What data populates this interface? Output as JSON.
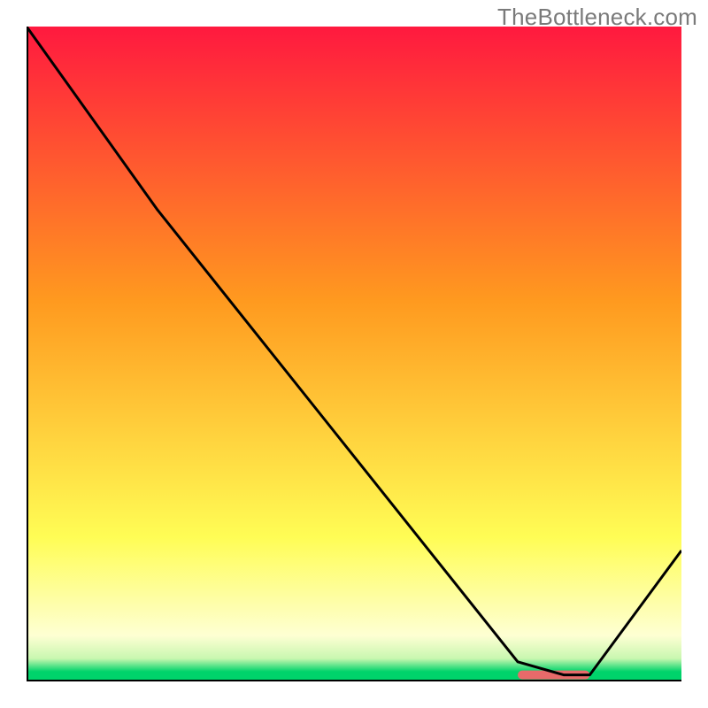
{
  "watermark": "TheBottleneck.com",
  "chart_data": {
    "type": "line",
    "title": "",
    "xlabel": "",
    "ylabel": "",
    "xlim": [
      0,
      100
    ],
    "ylim": [
      0,
      100
    ],
    "x": [
      0,
      20,
      75,
      82,
      86,
      100
    ],
    "values": [
      100,
      72,
      3,
      1,
      1,
      20
    ],
    "accent_segment": {
      "x": [
        75,
        86
      ],
      "y": 1
    },
    "colors": {
      "gradient_top": "#ff193f",
      "gradient_mid_upper": "#ff9a1f",
      "gradient_mid_lower": "#fffd55",
      "gradient_near_bottom": "#feffd3",
      "gradient_bottom": "#00d36b",
      "accent": "#e86a6a",
      "line": "#000000",
      "axis": "#000000"
    }
  }
}
